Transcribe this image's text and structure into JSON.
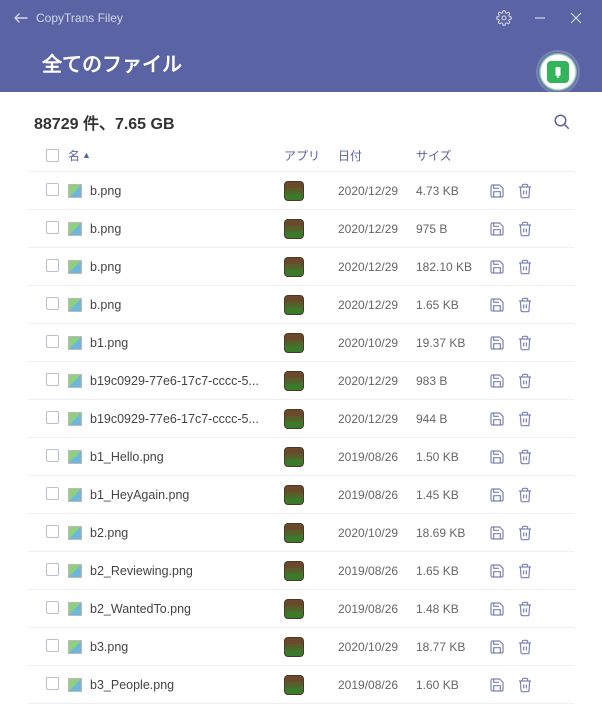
{
  "titlebar": {
    "app_name": "CopyTrans Filey"
  },
  "header": {
    "title": "全てのファイル"
  },
  "summary": {
    "text": "88729 件、7.65 GB"
  },
  "columns": {
    "name": "名",
    "sort_indicator": "▲",
    "app": "アプリ",
    "date": "日付",
    "size": "サイズ"
  },
  "rows": [
    {
      "name": "b.png",
      "date": "2020/12/29",
      "size": "4.73 KB"
    },
    {
      "name": "b.png",
      "date": "2020/12/29",
      "size": "975 B"
    },
    {
      "name": "b.png",
      "date": "2020/12/29",
      "size": "182.10 KB"
    },
    {
      "name": "b.png",
      "date": "2020/12/29",
      "size": "1.65 KB"
    },
    {
      "name": "b1.png",
      "date": "2020/10/29",
      "size": "19.37 KB"
    },
    {
      "name": "b19c0929-77e6-17c7-cccc-5...",
      "date": "2020/12/29",
      "size": "983 B"
    },
    {
      "name": "b19c0929-77e6-17c7-cccc-5...",
      "date": "2020/12/29",
      "size": "944 B"
    },
    {
      "name": "b1_Hello.png",
      "date": "2019/08/26",
      "size": "1.50 KB"
    },
    {
      "name": "b1_HeyAgain.png",
      "date": "2019/08/26",
      "size": "1.45 KB"
    },
    {
      "name": "b2.png",
      "date": "2020/10/29",
      "size": "18.69 KB"
    },
    {
      "name": "b2_Reviewing.png",
      "date": "2019/08/26",
      "size": "1.65 KB"
    },
    {
      "name": "b2_WantedTo.png",
      "date": "2019/08/26",
      "size": "1.48 KB"
    },
    {
      "name": "b3.png",
      "date": "2020/10/29",
      "size": "18.77 KB"
    },
    {
      "name": "b3_People.png",
      "date": "2019/08/26",
      "size": "1.60 KB"
    }
  ],
  "icons": {
    "save": "save-icon",
    "delete": "trash-icon"
  }
}
